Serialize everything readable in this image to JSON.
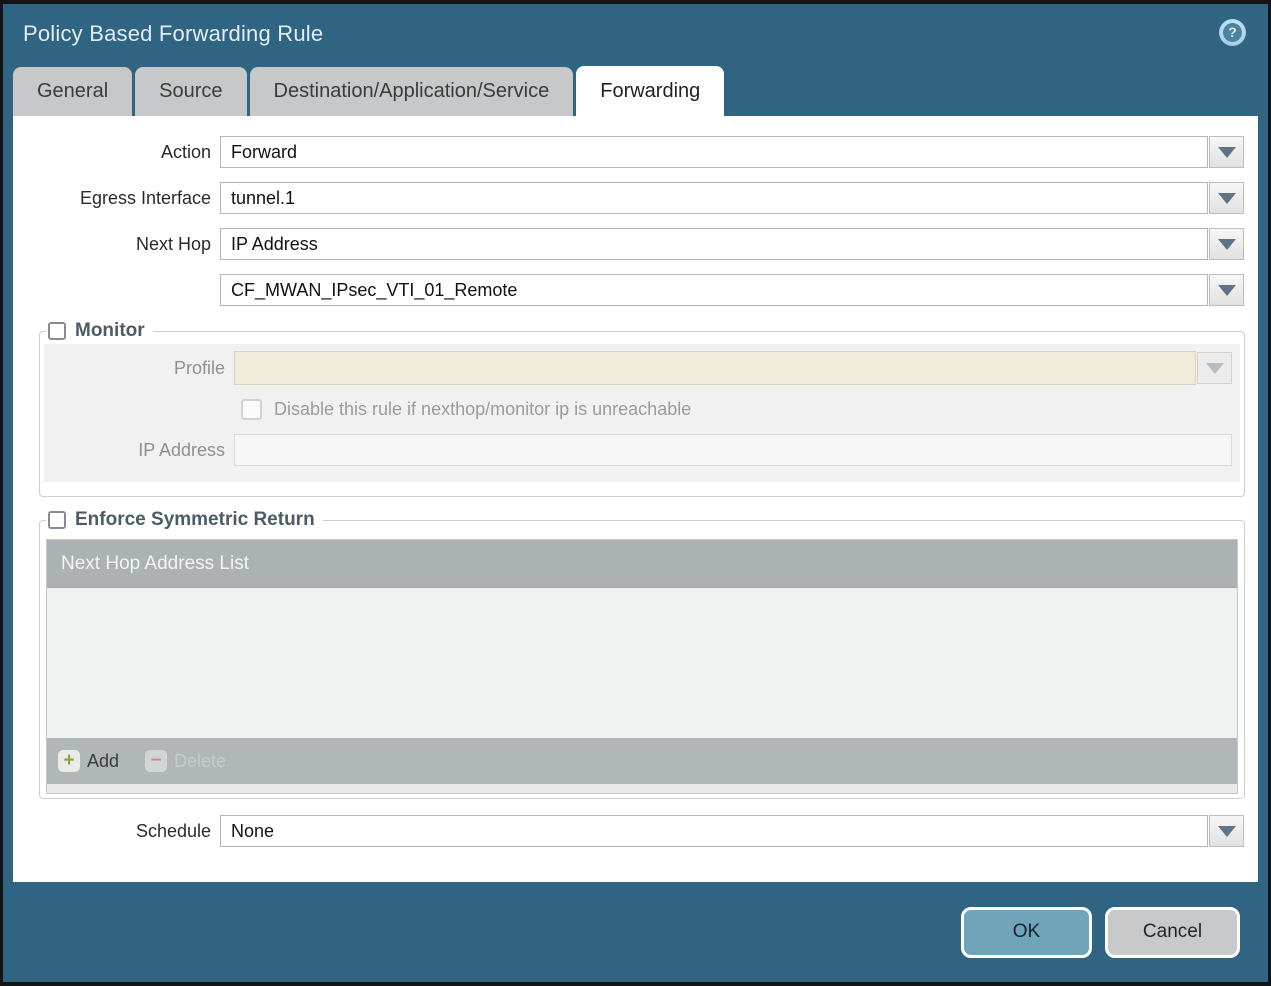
{
  "window": {
    "title": "Policy Based Forwarding Rule"
  },
  "icons": {
    "help_glyph": "?",
    "add_glyph": "+",
    "delete_glyph": "−"
  },
  "tabs": [
    {
      "label": "General",
      "active": false
    },
    {
      "label": "Source",
      "active": false
    },
    {
      "label": "Destination/Application/Service",
      "active": false
    },
    {
      "label": "Forwarding",
      "active": true
    }
  ],
  "form": {
    "action": {
      "label": "Action",
      "value": "Forward"
    },
    "egress_interface": {
      "label": "Egress Interface",
      "value": "tunnel.1"
    },
    "next_hop": {
      "label": "Next Hop",
      "value": "IP Address"
    },
    "next_hop_address": {
      "label": "",
      "value": "CF_MWAN_IPsec_VTI_01_Remote"
    },
    "schedule": {
      "label": "Schedule",
      "value": "None"
    }
  },
  "monitor": {
    "legend": "Monitor",
    "checked": false,
    "profile": {
      "label": "Profile",
      "value": ""
    },
    "disable_rule_label": "Disable this rule if nexthop/monitor ip is unreachable",
    "disable_rule_checked": false,
    "ip_address": {
      "label": "IP Address",
      "value": ""
    }
  },
  "symmetric_return": {
    "legend": "Enforce Symmetric Return",
    "checked": false,
    "table_header": "Next Hop Address List",
    "rows": [],
    "add_label": "Add",
    "delete_label": "Delete",
    "delete_enabled": false
  },
  "footer": {
    "ok_label": "OK",
    "cancel_label": "Cancel"
  },
  "colors": {
    "frame": "#2f6583",
    "tab_inactive": "#c7c8c9",
    "table_header": "#acb1b4",
    "ok_button": "#70a4b8",
    "cancel_button": "#c8c9ca",
    "disabled_field_beige": "#f1ebd9"
  }
}
